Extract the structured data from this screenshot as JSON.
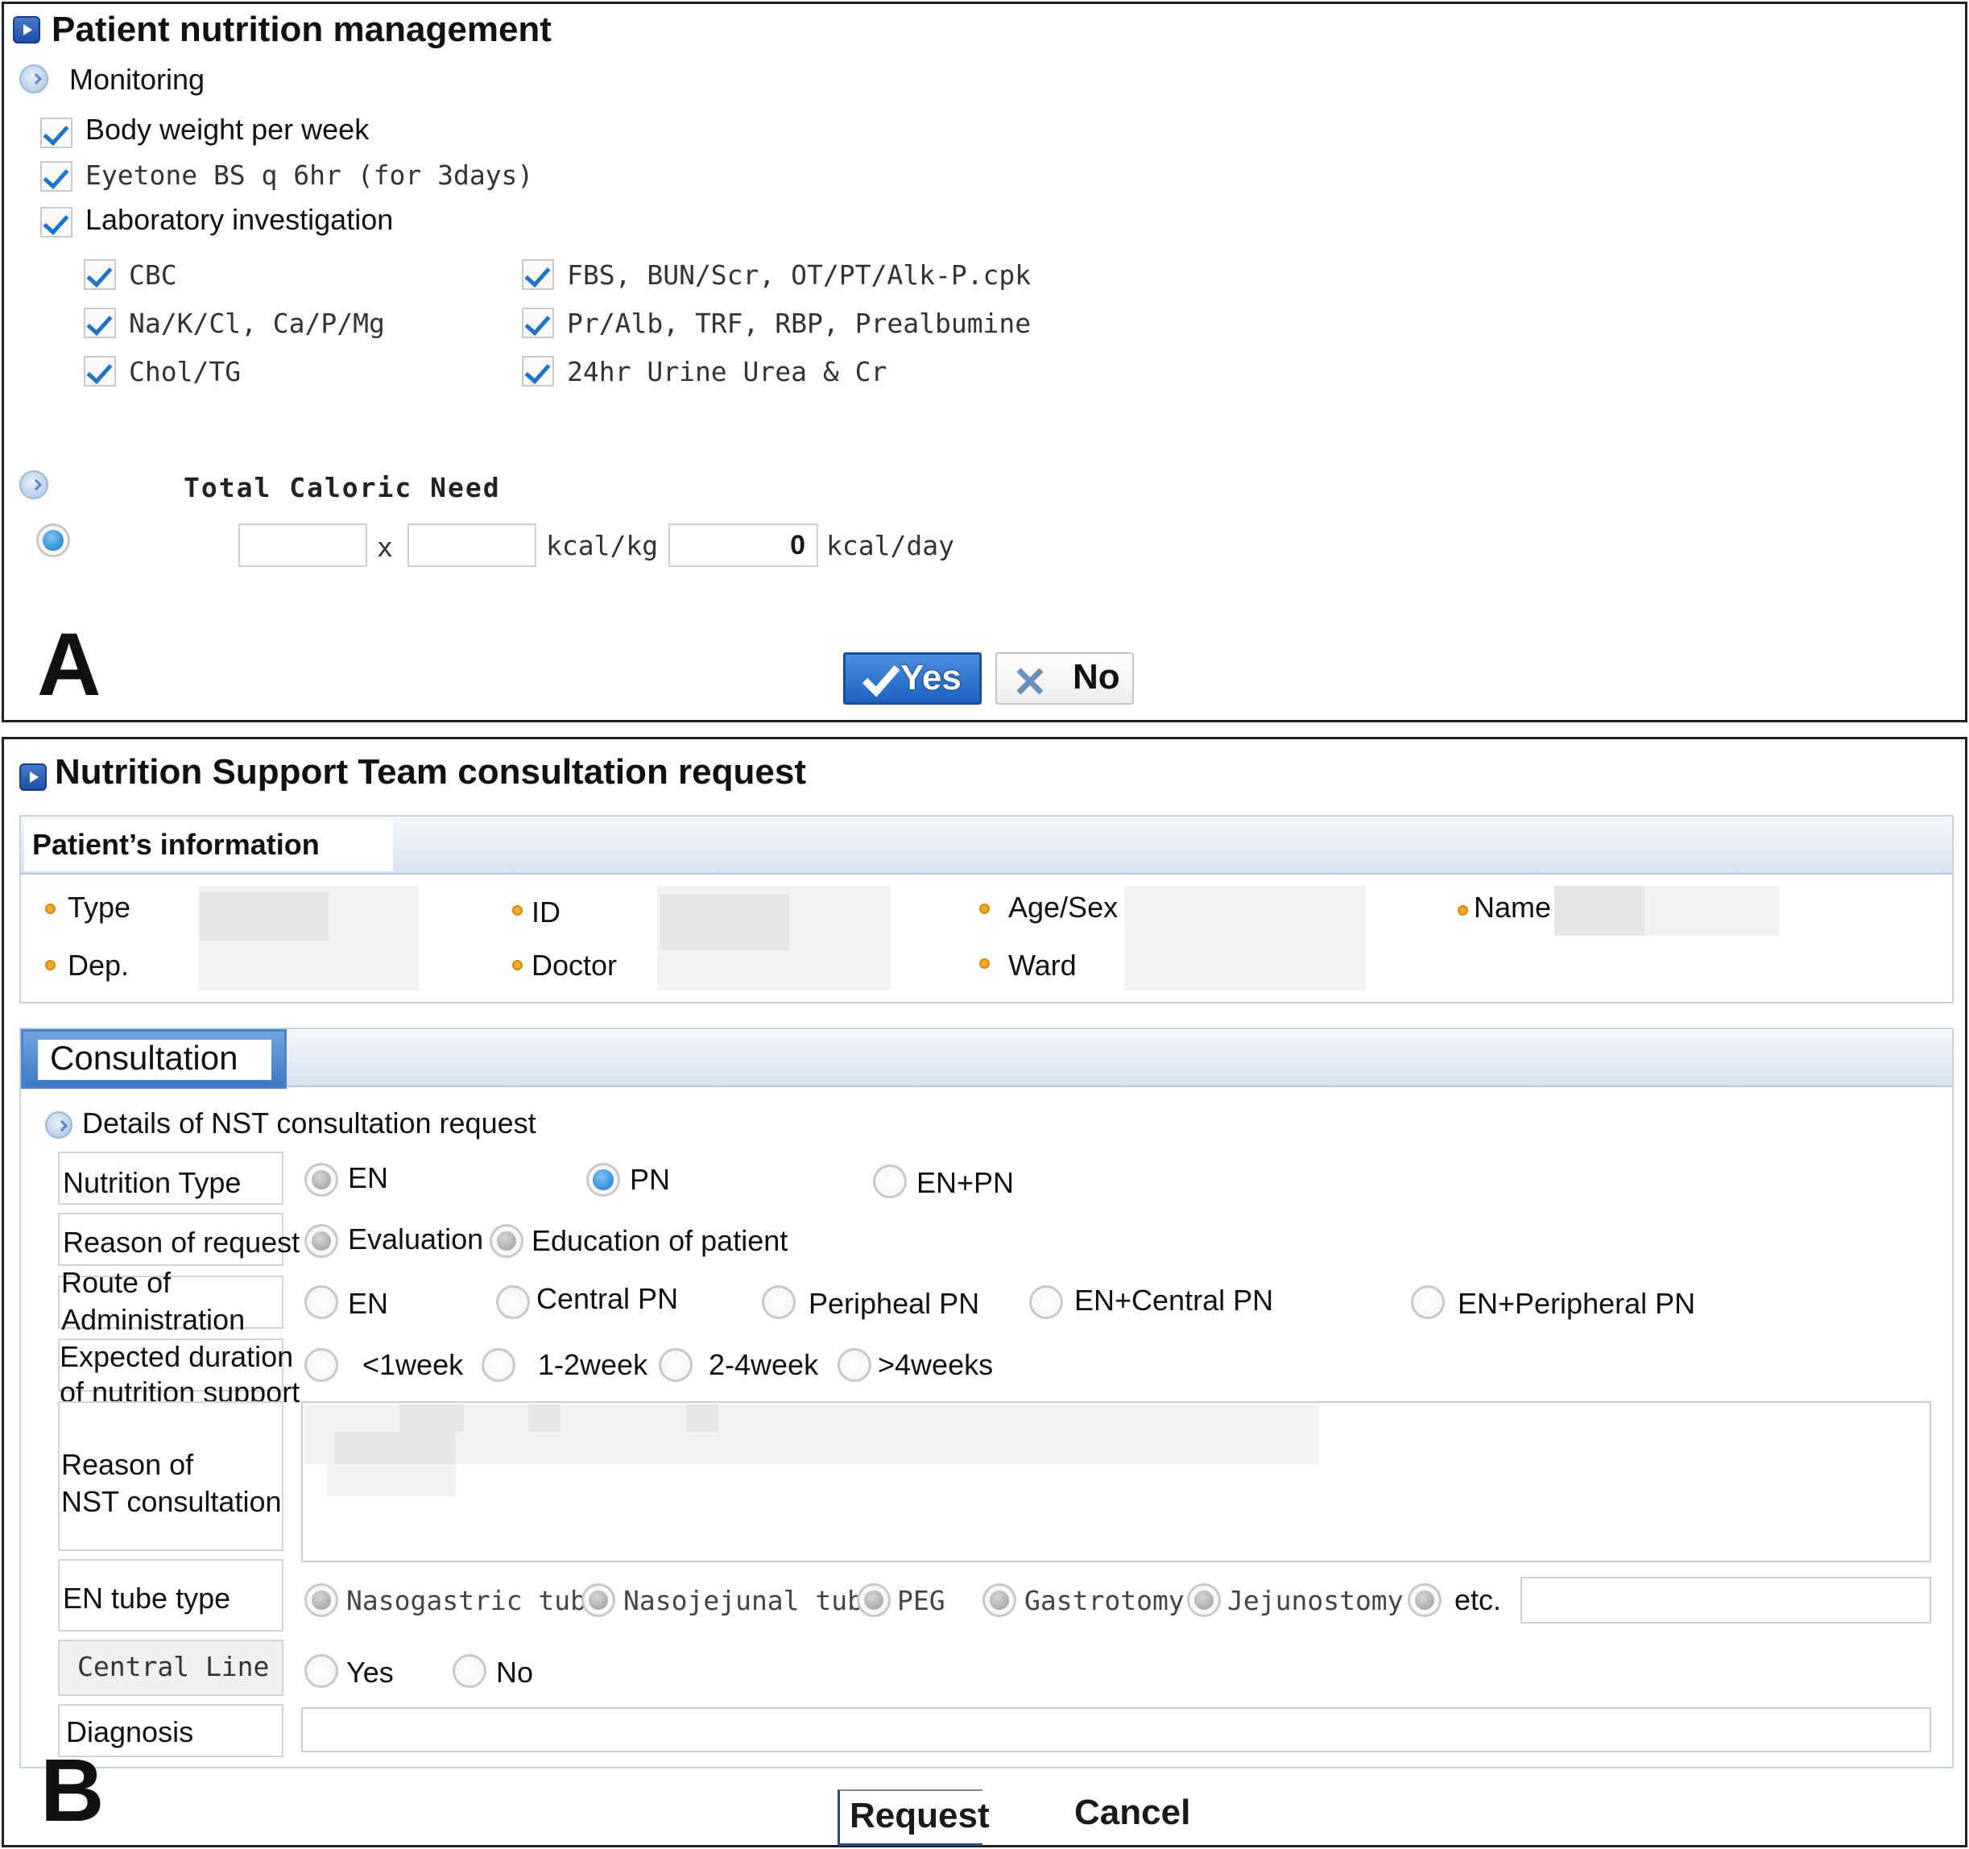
{
  "panelA": {
    "title": "Patient nutrition management",
    "monitoring": {
      "label": "Monitoring",
      "items": [
        {
          "label": "Body weight per week",
          "checked": true
        },
        {
          "label": "Eyetone BS q 6hr (for 3days)",
          "checked": true
        },
        {
          "label": "Laboratory investigation",
          "checked": true
        }
      ],
      "lab_items_left": [
        {
          "label": "CBC",
          "checked": true
        },
        {
          "label": "Na/K/Cl, Ca/P/Mg",
          "checked": true
        },
        {
          "label": "Chol/TG",
          "checked": true
        }
      ],
      "lab_items_right": [
        {
          "label": "FBS, BUN/Scr, OT/PT/Alk-P.cpk",
          "checked": true
        },
        {
          "label": "Pr/Alb, TRF, RBP, Prealbumine",
          "checked": true
        },
        {
          "label": "24hr Urine Urea & Cr",
          "checked": true
        }
      ]
    },
    "caloric": {
      "label": "Total Caloric Need",
      "weight_value": "",
      "kcal_per_kg_value": "",
      "times_symbol": "x",
      "unit1": "kcal/kg =",
      "result": "0",
      "unit2": "kcal/day"
    },
    "panel_letter": "A",
    "yes_label": "Yes",
    "no_label": "No"
  },
  "panelB": {
    "title": "Nutrition Support Team consultation request",
    "patient_info": {
      "heading": "Patient’s information",
      "fields": {
        "type": "Type",
        "id": "ID",
        "age_sex": "Age/Sex",
        "name": "Name",
        "dep": "Dep.",
        "doctor": "Doctor",
        "ward": "Ward"
      }
    },
    "consultation": {
      "tab": "Consultation",
      "details_label": "Details of NST consultation request",
      "nutrition_type": {
        "label": "Nutrition Type",
        "options": [
          "EN",
          "PN",
          "EN+PN"
        ],
        "selected": "PN"
      },
      "reason_of_request": {
        "label": "Reason of request",
        "options": [
          "Evaluation",
          "Education of patient"
        ]
      },
      "route": {
        "label_line1": "Route of",
        "label_line2": "Administration",
        "options": [
          "EN",
          "Central PN",
          "Peripheal PN",
          "EN+Central PN",
          "EN+Peripheral PN"
        ]
      },
      "duration": {
        "label_line1": "Expected duration",
        "label_line2": "of nutrition support",
        "options": [
          "<1week",
          "1-2week",
          "2-4week",
          ">4weeks"
        ]
      },
      "reason_nst": {
        "label_line1": "Reason of",
        "label_line2": "NST consultation"
      },
      "en_tube": {
        "label": "EN tube type",
        "options": [
          "Nasogastric tube",
          "Nasojejunal tube",
          "PEG",
          "Gastrotomy",
          "Jejunostomy",
          "etc."
        ]
      },
      "central_line": {
        "label": "Central Line",
        "options": [
          "Yes",
          "No"
        ]
      },
      "diagnosis": {
        "label": "Diagnosis"
      }
    },
    "panel_letter": "B",
    "request_label": "Request",
    "cancel_label": "Cancel"
  },
  "colors": {
    "accent": "#1c62c0",
    "bullet": "#f0a830",
    "header_bg": "#d7e3f0"
  }
}
